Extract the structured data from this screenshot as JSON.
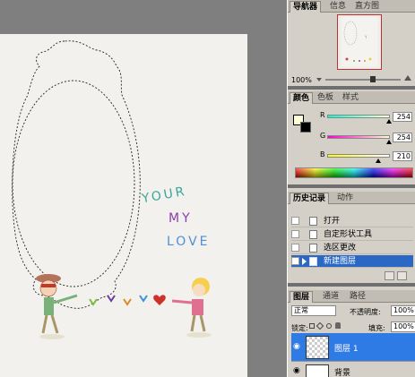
{
  "navigator_panel": {
    "tabs": [
      "导航器",
      "信息",
      "直方图"
    ],
    "zoom": "100%"
  },
  "color_panel": {
    "tabs": [
      "颜色",
      "色板",
      "样式"
    ],
    "channels": [
      {
        "label": "R",
        "value": "254",
        "level": 0.996
      },
      {
        "label": "G",
        "value": "254",
        "level": 0.996
      },
      {
        "label": "B",
        "value": "210",
        "level": 0.824
      }
    ],
    "foreground": "#FEFED2",
    "background": "#000000"
  },
  "history_panel": {
    "tabs": [
      "历史记录",
      "动作"
    ],
    "items": [
      "打开",
      "自定形状工具",
      "选区更改",
      "新建图层"
    ],
    "selected_index": 3
  },
  "layers_panel": {
    "tabs": [
      "图层",
      "通道",
      "路径"
    ],
    "blend_mode": "正常",
    "opacity_label": "不透明度:",
    "opacity": "100%",
    "lock_label": "锁定:",
    "fill_label": "填充:",
    "fill": "100%",
    "layers": [
      {
        "name": "图层 1",
        "selected": true
      },
      {
        "name": "背景",
        "selected": false
      }
    ]
  },
  "canvas": {
    "love_lines": [
      "YOUR",
      "MY",
      "LOVE"
    ]
  }
}
